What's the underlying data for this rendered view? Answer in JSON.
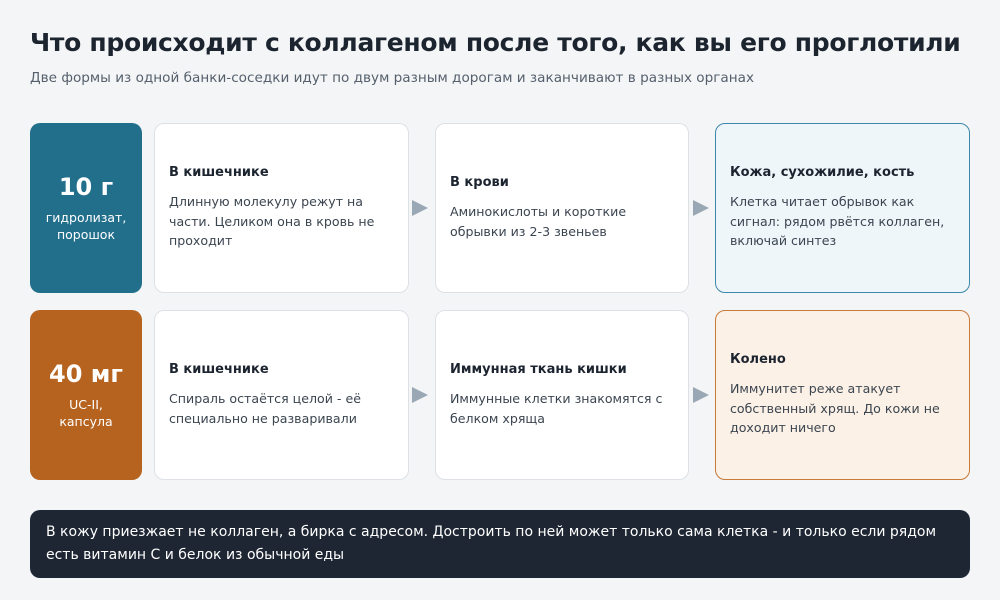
{
  "header": {
    "title": "Что происходит с коллагеном после того, как вы его проглотили",
    "subtitle": "Две формы из одной банки-соседки идут по двум разным дорогам и заканчивают в разных органах"
  },
  "rows": [
    {
      "dose": {
        "amount": "10 г",
        "desc_line1": "гидролизат,",
        "desc_line2": "порошок"
      },
      "steps": [
        {
          "title": "В кишечнике",
          "text": "Длинную молекулу режут на части. Целиком она в кровь не проходит"
        },
        {
          "title": "В крови",
          "text": "Аминокислоты и короткие обрывки из 2-3 звеньев"
        },
        {
          "title": "Кожа, сухожилие, кость",
          "text": "Клетка читает обрывок как сигнал: рядом рвётся коллаген, включай синтез"
        }
      ]
    },
    {
      "dose": {
        "amount": "40 мг",
        "desc_line1": "UC-II,",
        "desc_line2": "капсула"
      },
      "steps": [
        {
          "title": "В кишечнике",
          "text": "Спираль остаётся целой - её специально не разваривали"
        },
        {
          "title": "Иммунная ткань кишки",
          "text": "Иммунные клетки знакомятся с белком хряща"
        },
        {
          "title": "Колено",
          "text": "Иммунитет реже атакует собственный хрящ. До кожи не доходит ничего"
        }
      ]
    }
  ],
  "note": "В кожу приезжает не коллаген, а бирка с адресом. Достроить по ней может только сама клетка - и только если рядом есть витамин С и белок из обычной еды",
  "colors": {
    "dose_blue": "#226f8c",
    "dose_orange": "#b5631f",
    "arrow": "#9aa8b6",
    "note_bg": "#1e2633"
  }
}
